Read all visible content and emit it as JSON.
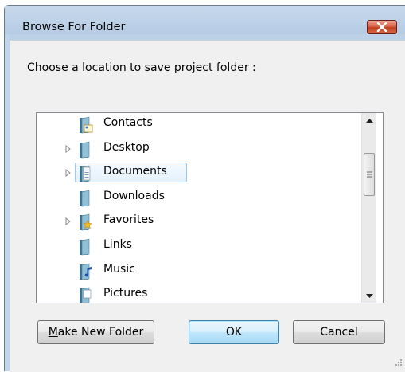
{
  "window": {
    "title": "Browse For Folder",
    "close_label": "×"
  },
  "prompt": "Choose a location to save project folder :",
  "tree": {
    "items": [
      {
        "label": "Contacts",
        "icon": "contacts-folder-icon",
        "expandable": false,
        "selected": false
      },
      {
        "label": "Desktop",
        "icon": "desktop-folder-icon",
        "expandable": true,
        "selected": false
      },
      {
        "label": "Documents",
        "icon": "documents-folder-icon",
        "expandable": true,
        "selected": true
      },
      {
        "label": "Downloads",
        "icon": "downloads-folder-icon",
        "expandable": false,
        "selected": false
      },
      {
        "label": "Favorites",
        "icon": "favorites-folder-icon",
        "expandable": true,
        "selected": false
      },
      {
        "label": "Links",
        "icon": "links-folder-icon",
        "expandable": false,
        "selected": false
      },
      {
        "label": "Music",
        "icon": "music-folder-icon",
        "expandable": false,
        "selected": false
      },
      {
        "label": "Pictures",
        "icon": "pictures-folder-icon",
        "expandable": false,
        "selected": false
      }
    ]
  },
  "buttons": {
    "make_new_folder": "Make New Folder",
    "make_new_folder_mnemonic": "M",
    "make_new_folder_rest": "ake New Folder",
    "ok": "OK",
    "cancel": "Cancel"
  },
  "colors": {
    "frame": "#bcd0e6",
    "client": "#f0f0f0",
    "close_button": "#c1401f",
    "selection_border": "#99c9ef",
    "default_button_border": "#3c7fb1"
  }
}
